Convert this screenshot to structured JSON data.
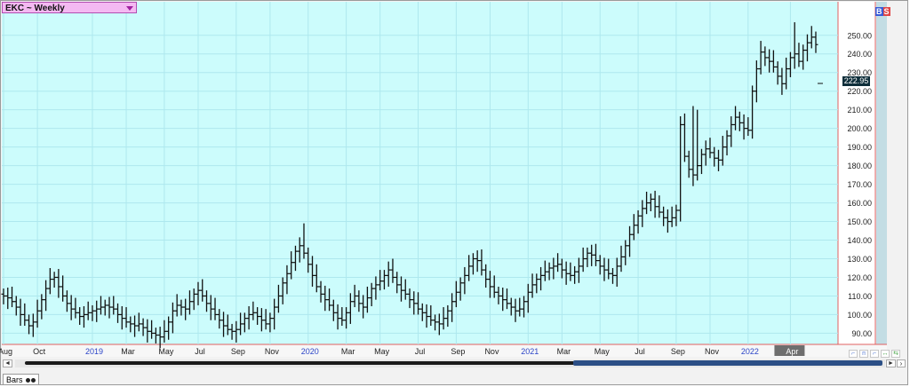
{
  "window": {
    "symbol_label": "EKC ~ Weekly",
    "bs_buy": "B",
    "bs_sell": "S",
    "bottom_tab": "Bars",
    "current_price": "222.95",
    "colors": {
      "plot_bg": "#ccfcfc",
      "grid": "#aee8ee",
      "bar": "#111111",
      "axis_red": "#e06060",
      "symbol_box": "#f4b9f2"
    }
  },
  "chart_data": {
    "type": "ohlc-bar",
    "title": "",
    "xlabel": "",
    "ylabel": "",
    "ylim": [
      84,
      268
    ],
    "grid": true,
    "y_ticks": [
      "90.00",
      "100.00",
      "110.00",
      "120.00",
      "130.00",
      "140.00",
      "150.00",
      "160.00",
      "170.00",
      "180.00",
      "190.00",
      "200.00",
      "210.00",
      "220.00",
      "230.00",
      "240.00",
      "250.00"
    ],
    "x_ticks": [
      {
        "label": "Aug",
        "week": 0,
        "year": false
      },
      {
        "label": "Oct",
        "week": 8,
        "year": false
      },
      {
        "label": "2019",
        "week": 21,
        "year": true
      },
      {
        "label": "Mar",
        "week": 29,
        "year": false
      },
      {
        "label": "May",
        "week": 38,
        "year": false
      },
      {
        "label": "Jul",
        "week": 46,
        "year": false
      },
      {
        "label": "Sep",
        "week": 55,
        "year": false
      },
      {
        "label": "Nov",
        "week": 63,
        "year": false
      },
      {
        "label": "2020",
        "week": 72,
        "year": true
      },
      {
        "label": "Mar",
        "week": 81,
        "year": false
      },
      {
        "label": "May",
        "week": 89,
        "year": false
      },
      {
        "label": "Jul",
        "week": 98,
        "year": false
      },
      {
        "label": "Sep",
        "week": 107,
        "year": false
      },
      {
        "label": "Nov",
        "week": 115,
        "year": false
      },
      {
        "label": "2021",
        "week": 124,
        "year": true
      },
      {
        "label": "Mar",
        "week": 132,
        "year": false
      },
      {
        "label": "May",
        "week": 141,
        "year": false
      },
      {
        "label": "Jul",
        "week": 150,
        "year": false
      },
      {
        "label": "Sep",
        "week": 159,
        "year": false
      },
      {
        "label": "Nov",
        "week": 167,
        "year": false
      },
      {
        "label": "2022",
        "week": 176,
        "year": true
      },
      {
        "label": "Apr",
        "week": 186,
        "year": false,
        "highlight": true
      }
    ],
    "last_price": 222.95,
    "closes": [
      110,
      109,
      107,
      104,
      100,
      97,
      94,
      96,
      102,
      108,
      114,
      119,
      120,
      115,
      110,
      106,
      103,
      101,
      99,
      100,
      101,
      102,
      103,
      104,
      105,
      104,
      103,
      100,
      98,
      96,
      95,
      94,
      95,
      93,
      91,
      90,
      89,
      88,
      91,
      96,
      102,
      105,
      104,
      103,
      107,
      111,
      113,
      110,
      106,
      103,
      100,
      97,
      94,
      92,
      91,
      92,
      95,
      98,
      100,
      101,
      99,
      97,
      95,
      98,
      104,
      110,
      117,
      122,
      128,
      134,
      137,
      133,
      127,
      121,
      115,
      111,
      108,
      105,
      101,
      98,
      97,
      101,
      107,
      110,
      106,
      104,
      109,
      114,
      116,
      118,
      121,
      124,
      120,
      116,
      113,
      111,
      108,
      106,
      103,
      101,
      99,
      97,
      96,
      95,
      98,
      102,
      107,
      112,
      117,
      121,
      126,
      130,
      129,
      124,
      119,
      115,
      112,
      110,
      108,
      106,
      104,
      102,
      103,
      107,
      112,
      116,
      119,
      121,
      123,
      125,
      126,
      127,
      124,
      122,
      121,
      123,
      126,
      130,
      133,
      132,
      129,
      126,
      124,
      122,
      121,
      126,
      131,
      137,
      143,
      148,
      153,
      157,
      160,
      162,
      158,
      155,
      152,
      150,
      152,
      156,
      202,
      185,
      178,
      175,
      180,
      186,
      189,
      187,
      184,
      183,
      190,
      196,
      202,
      206,
      203,
      200,
      199,
      220,
      232,
      241,
      238,
      236,
      233,
      228,
      224,
      232,
      238,
      240,
      236,
      242,
      246,
      249,
      245
    ]
  }
}
